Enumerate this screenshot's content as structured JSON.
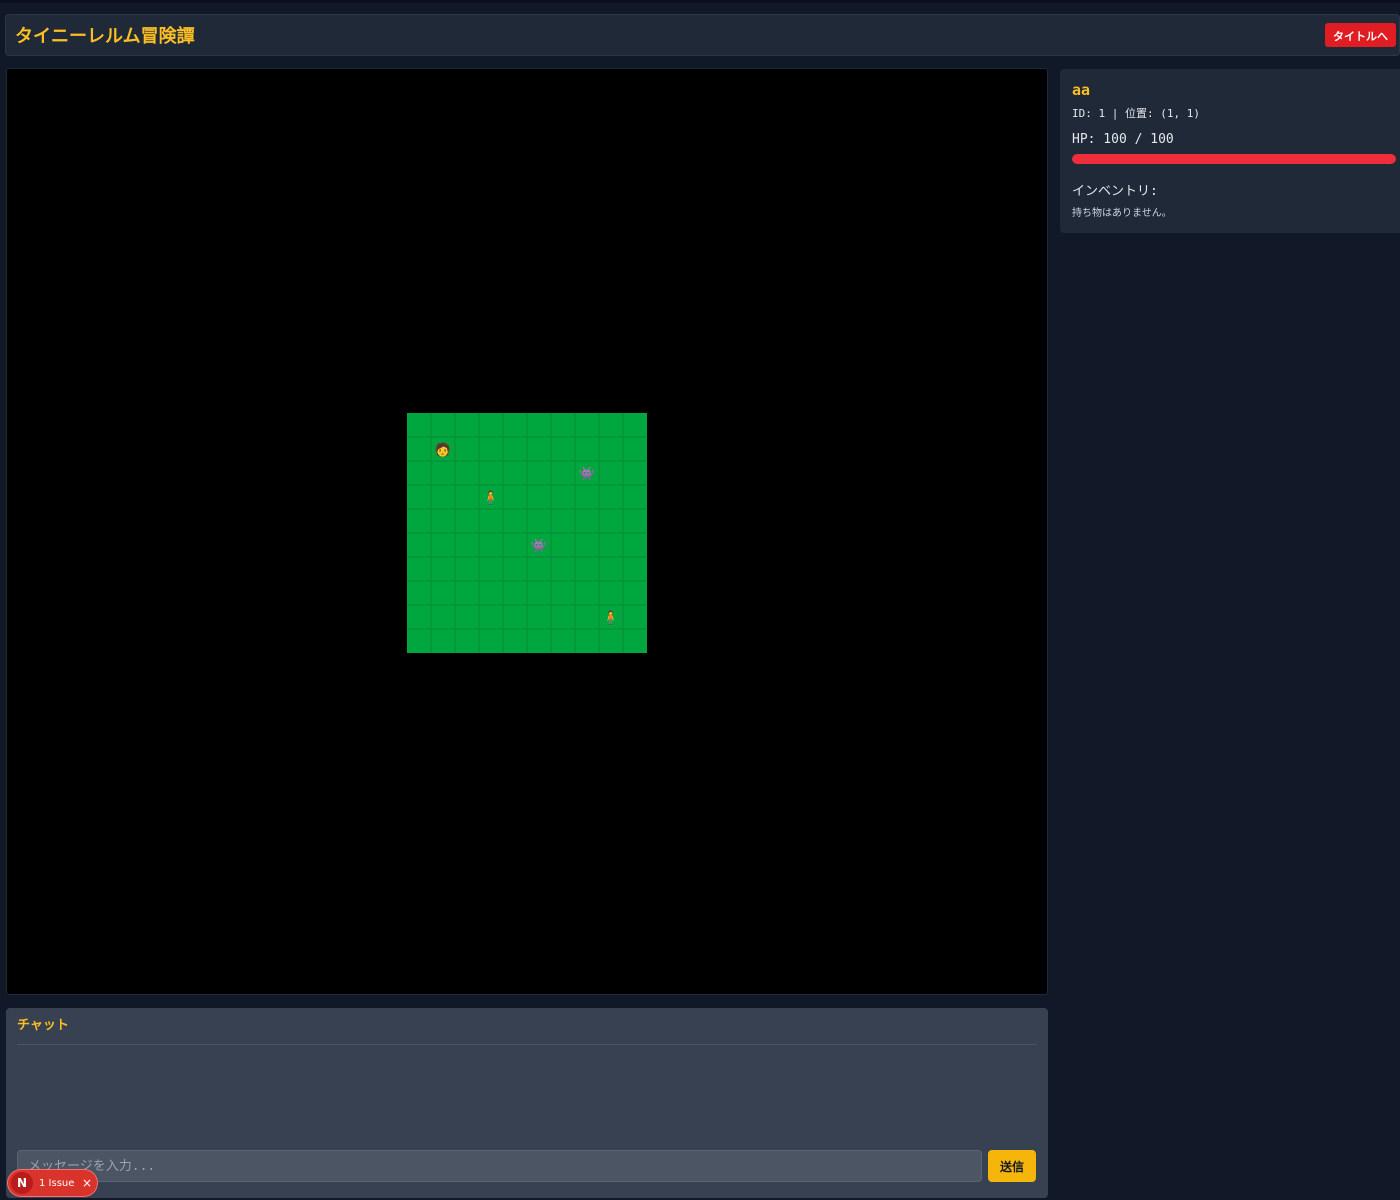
{
  "header": {
    "title": "タイニーレルム冒険譚",
    "title_button": "タイトルへ"
  },
  "map": {
    "cols": 10,
    "rows": 10,
    "grass_color": "#00a63e",
    "grid_color": "#0a8a35",
    "entities": [
      {
        "type": "player",
        "icon": "person-face-icon",
        "glyph": "🧑",
        "x": 1,
        "y": 1
      },
      {
        "type": "monster",
        "icon": "space-invader-icon",
        "glyph": "👾",
        "x": 7,
        "y": 2
      },
      {
        "type": "npc",
        "icon": "standing-person-icon",
        "glyph": "🧍",
        "x": 3,
        "y": 3
      },
      {
        "type": "monster",
        "icon": "space-invader-icon",
        "glyph": "👾",
        "x": 5,
        "y": 5
      },
      {
        "type": "npc",
        "icon": "standing-person-icon",
        "glyph": "🧍",
        "x": 8,
        "y": 8
      }
    ]
  },
  "chat": {
    "title": "チャット",
    "placeholder": "メッセージを入力...",
    "send_label": "送信"
  },
  "player": {
    "name": "aa",
    "info": "ID: 1 | 位置: (1, 1)",
    "hp_text": "HP: 100 / 100",
    "hp": 100,
    "hp_max": 100,
    "inventory_label": "インベントリ:",
    "inventory_empty": "持ち物はありません。"
  },
  "issues_badge": {
    "logo": "N",
    "label": "1 Issue",
    "close": "×"
  },
  "colors": {
    "accent": "#fbbf24",
    "danger": "#e11d24",
    "hp_bar": "#ef2d3b"
  }
}
